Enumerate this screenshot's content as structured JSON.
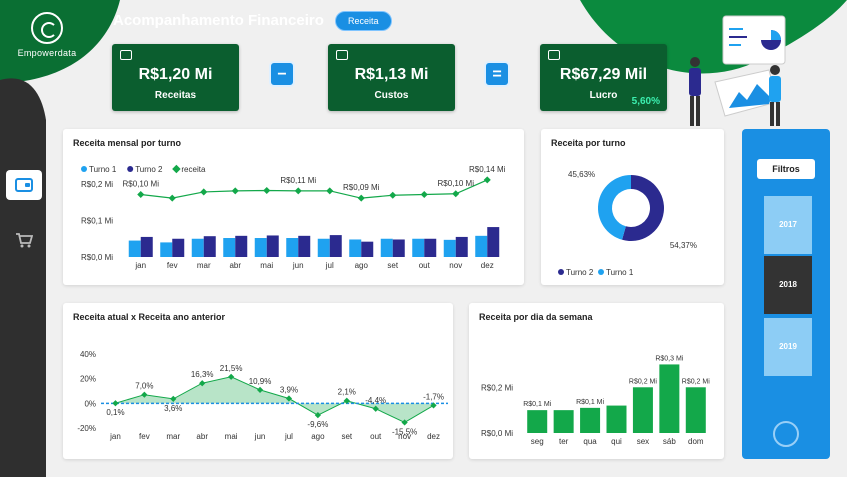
{
  "brand": {
    "name": "Empowerdata"
  },
  "header": {
    "title": "Acompanhamento Financeiro",
    "badge": "Receita"
  },
  "kpis": [
    {
      "value": "R$1,20 Mi",
      "label": "Receitas"
    },
    {
      "value": "R$1,13 Mi",
      "label": "Custos"
    },
    {
      "value": "R$67,29 Mil",
      "label": "Lucro",
      "pct": "5,60%"
    }
  ],
  "operators": {
    "minus": "−",
    "equals": "="
  },
  "icons": {
    "nav_wallet": "wallet-icon",
    "nav_cart": "cart-icon"
  },
  "colors": {
    "green_dark": "#0b5e2f",
    "green": "#13a84a",
    "blue": "#1a8fe3",
    "light_blue": "#1fa2f0",
    "navy": "#2b2a8f"
  },
  "filters": {
    "title": "Filtros",
    "years": [
      "2017",
      "2018",
      "2019"
    ],
    "selected": "2018"
  },
  "chart_data": [
    {
      "title": "Receita mensal por turno",
      "type": "bar",
      "categories": [
        "jan",
        "fev",
        "mar",
        "abr",
        "mai",
        "jun",
        "jul",
        "ago",
        "set",
        "out",
        "nov",
        "dez"
      ],
      "series": [
        {
          "name": "Turno 1",
          "values": [
            0.045,
            0.04,
            0.05,
            0.052,
            0.052,
            0.052,
            0.05,
            0.048,
            0.05,
            0.05,
            0.047,
            0.058
          ]
        },
        {
          "name": "Turno 2",
          "values": [
            0.055,
            0.05,
            0.057,
            0.058,
            0.059,
            0.058,
            0.06,
            0.042,
            0.048,
            0.05,
            0.055,
            0.082
          ]
        },
        {
          "name": "receita",
          "type": "line",
          "values": [
            0.1,
            0.09,
            0.107,
            0.11,
            0.111,
            0.11,
            0.11,
            0.09,
            0.098,
            0.1,
            0.102,
            0.14
          ]
        }
      ],
      "point_labels": [
        "R$0,10 Mi",
        "",
        "",
        "",
        "",
        "R$0,11 Mi",
        "",
        "R$0,09 Mi",
        "",
        "",
        "R$0,10 Mi",
        "R$0,14 Mi"
      ],
      "yticks": [
        "R$0,0 Mi",
        "R$0,1 Mi",
        "R$0,2 Mi"
      ],
      "ylim": [
        0,
        0.2
      ],
      "legend": "top-left"
    },
    {
      "title": "Receita por turno",
      "type": "pie",
      "slices": [
        {
          "name": "Turno 2",
          "value": 54.37,
          "label": "54,37%"
        },
        {
          "name": "Turno 1",
          "value": 45.63,
          "label": "45,63%"
        }
      ],
      "legend": "bottom-left"
    },
    {
      "title": "Receita atual x Receita ano anterior",
      "type": "area",
      "categories": [
        "jan",
        "fev",
        "mar",
        "abr",
        "mai",
        "jun",
        "jul",
        "ago",
        "set",
        "out",
        "nov",
        "dez"
      ],
      "values": [
        0.1,
        7.0,
        3.6,
        16.3,
        21.5,
        10.9,
        3.9,
        -9.6,
        2.1,
        -4.4,
        -15.5,
        -1.7
      ],
      "labels": [
        "0,1%",
        "7,0%",
        "3,6%",
        "16,3%",
        "21,5%",
        "10,9%",
        "3,9%",
        "-9,6%",
        "2,1%",
        "-4,4%",
        "-15,5%",
        "-1,7%"
      ],
      "yticks": [
        "40%",
        "20%",
        "0%",
        "-20%"
      ],
      "ylim": [
        -20,
        40
      ]
    },
    {
      "title": "Receita por dia da semana",
      "type": "bar",
      "categories": [
        "seg",
        "ter",
        "qua",
        "qui",
        "sex",
        "sáb",
        "dom"
      ],
      "values": [
        0.1,
        0.1,
        0.11,
        0.12,
        0.2,
        0.3,
        0.2
      ],
      "labels": [
        "R$0,1 Mi",
        "",
        "R$0,1 Mi",
        "",
        "R$0,2 Mi",
        "R$0,3 Mi",
        "R$0,2 Mi"
      ],
      "yticks": [
        "R$0,0 Mi",
        "R$0,2 Mi"
      ],
      "ylim": [
        0,
        0.35
      ]
    }
  ]
}
